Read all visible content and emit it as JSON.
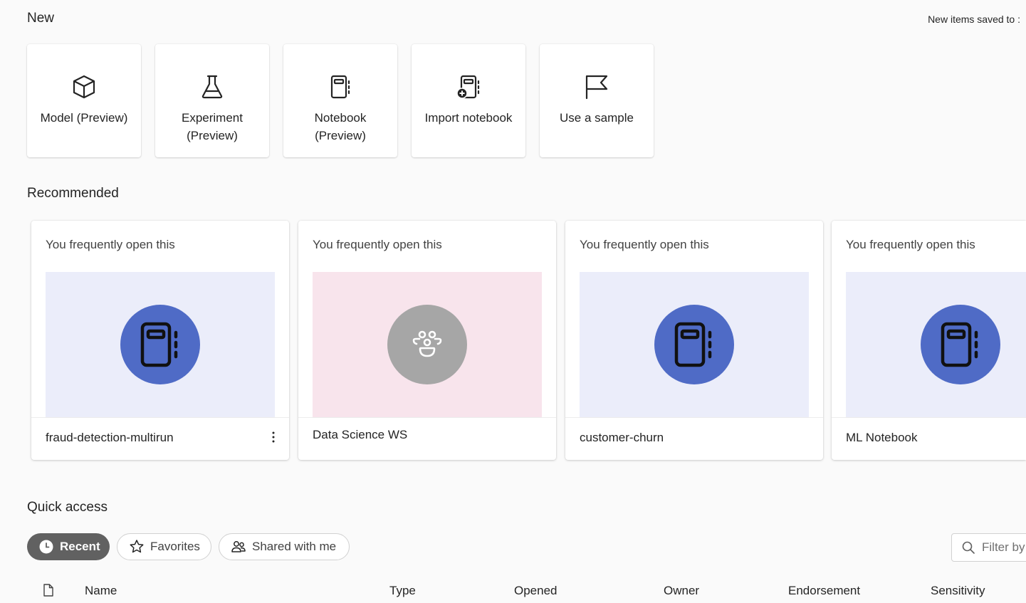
{
  "header": {
    "new_title": "New",
    "saved_to": "New items saved to :"
  },
  "new_items": [
    {
      "label": "Model (Preview)",
      "icon": "cube-icon"
    },
    {
      "label": "Experiment (Preview)",
      "icon": "flask-icon"
    },
    {
      "label": "Notebook (Preview)",
      "icon": "notebook-icon"
    },
    {
      "label": "Import notebook",
      "icon": "import-notebook-icon"
    },
    {
      "label": "Use a sample",
      "icon": "flag-icon"
    }
  ],
  "recommended": {
    "title": "Recommended",
    "cards": [
      {
        "subtitle": "You frequently open this",
        "name": "fraud-detection-multirun",
        "icon": "notebook-icon",
        "thumb_bg": "#ebedfa",
        "circle_color": "#4f6bc6"
      },
      {
        "subtitle": "You frequently open this",
        "name": "Data Science WS",
        "icon": "workspace-people-icon",
        "thumb_bg": "#f8e4ec",
        "circle_color": "#a6a6a6"
      },
      {
        "subtitle": "You frequently open this",
        "name": "customer-churn",
        "icon": "notebook-icon",
        "thumb_bg": "#ebedfa",
        "circle_color": "#4f6bc6"
      },
      {
        "subtitle": "You frequently open this",
        "name": "ML Notebook",
        "icon": "notebook-icon",
        "thumb_bg": "#ebedfa",
        "circle_color": "#4f6bc6"
      }
    ]
  },
  "quick_access": {
    "title": "Quick access",
    "tabs": [
      {
        "label": "Recent",
        "icon": "clock-icon",
        "selected": true
      },
      {
        "label": "Favorites",
        "icon": "star-icon",
        "selected": false
      },
      {
        "label": "Shared with me",
        "icon": "people-icon",
        "selected": false
      }
    ],
    "filter_placeholder": "Filter by keyword",
    "columns": [
      "Name",
      "Type",
      "Opened",
      "Owner",
      "Endorsement",
      "Sensitivity"
    ]
  }
}
